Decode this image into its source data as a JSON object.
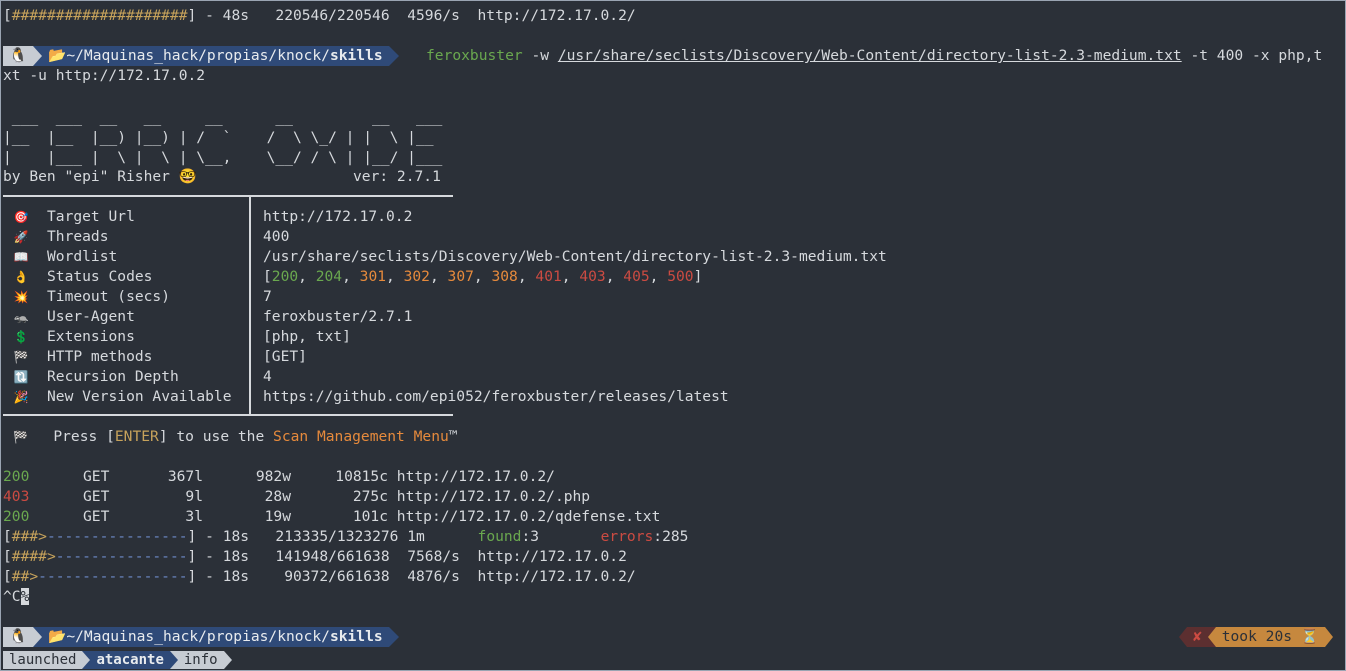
{
  "top_progress": {
    "bar": "####################",
    "time": "- 48s",
    "count": "220546/220546",
    "rate": "4596/s",
    "url": "http://172.17.0.2/"
  },
  "prompt": {
    "os_icon": "🐧",
    "folder_icon": "📂",
    "path_prefix": "~/Maquinas_hack/propias/knock/",
    "path_bold": "skills"
  },
  "command": {
    "program": "feroxbuster",
    "arg1": "-w",
    "wordlist": "/usr/share/seclists/Discovery/Web-Content/directory-list-2.3-medium.txt",
    "rest": "-t 400 -x php,t",
    "wrap": "xt -u http://172.17.0.2"
  },
  "banner": {
    "art": [
      " ___  ___  __   __     __      __         __   ___",
      "|__  |__  |__) |__) | /  `    /  \\ \\_/ | |  \\ |__",
      "|    |___ |  \\ |  \\ | \\__,    \\__/ / \\ | |__/ |___"
    ],
    "byline": "by Ben \"epi\" Risher",
    "emoji": "🤓",
    "version": "ver: 2.7.1"
  },
  "config": [
    {
      "icon": "🎯",
      "label": "Target Url",
      "value": "http://172.17.0.2"
    },
    {
      "icon": "🚀",
      "label": "Threads",
      "value": "400"
    },
    {
      "icon": "📖",
      "label": "Wordlist",
      "value": "/usr/share/seclists/Discovery/Web-Content/directory-list-2.3-medium.txt"
    },
    {
      "icon": "👌",
      "label": "Status Codes",
      "value": ""
    },
    {
      "icon": "💥",
      "label": "Timeout (secs)",
      "value": "7"
    },
    {
      "icon": "🦡",
      "label": "User-Agent",
      "value": "feroxbuster/2.7.1"
    },
    {
      "icon": "💲",
      "label": "Extensions",
      "value": "[php, txt]"
    },
    {
      "icon": "🏁",
      "label": "HTTP methods",
      "value": "[GET]"
    },
    {
      "icon": "🔃",
      "label": "Recursion Depth",
      "value": "4"
    },
    {
      "icon": "🎉",
      "label": "New Version Available",
      "value": "https://github.com/epi052/feroxbuster/releases/latest"
    }
  ],
  "status_codes": [
    {
      "code": "200",
      "color": "#6aa84f"
    },
    {
      "code": "204",
      "color": "#6aa84f"
    },
    {
      "code": "301",
      "color": "#e68a3c"
    },
    {
      "code": "302",
      "color": "#e68a3c"
    },
    {
      "code": "307",
      "color": "#e68a3c"
    },
    {
      "code": "308",
      "color": "#e68a3c"
    },
    {
      "code": "401",
      "color": "#cc4b42"
    },
    {
      "code": "403",
      "color": "#cc4b42"
    },
    {
      "code": "405",
      "color": "#cc4b42"
    },
    {
      "code": "500",
      "color": "#cc4b42"
    }
  ],
  "scan_menu": {
    "icon": "🏁",
    "pre": "Press [",
    "key": "ENTER",
    "mid": "] to use the ",
    "menu": "Scan Management Menu",
    "tm": "™"
  },
  "results": [
    {
      "status": "200",
      "color": "#6aa84f",
      "method": "GET",
      "lines": "367l",
      "words": "982w",
      "chars": "10815c",
      "url": "http://172.17.0.2/"
    },
    {
      "status": "403",
      "color": "#cc4b42",
      "method": "GET",
      "lines": "9l",
      "words": "28w",
      "chars": "275c",
      "url": "http://172.17.0.2/.php"
    },
    {
      "status": "200",
      "color": "#6aa84f",
      "method": "GET",
      "lines": "3l",
      "words": "19w",
      "chars": "101c",
      "url": "http://172.17.0.2/qdefense.txt"
    }
  ],
  "progress": [
    {
      "fill": "###>",
      "rest": "----------------",
      "time": "- 18s",
      "count": "213335/1323276",
      "rate": "1m",
      "found_label": "found",
      "found": "3",
      "errors_label": "errors",
      "errors": "285",
      "url": ""
    },
    {
      "fill": "####>",
      "rest": "---------------",
      "time": "- 18s",
      "count": "141948/661638",
      "rate": "7568/s",
      "url": "http://172.17.0.2"
    },
    {
      "fill": "##>",
      "rest": "-----------------",
      "time": "- 18s",
      "count": "90372/661638",
      "rate": "4876/s",
      "url": "http://172.17.0.2/"
    }
  ],
  "interrupt": {
    "ctrl": "^C",
    "cursor": "%"
  },
  "right_prompt": {
    "exit_icon": "✘",
    "took": "took 20s",
    "hourglass": "⏳"
  },
  "tmux": {
    "tabs": [
      {
        "label": "launched",
        "active": false
      },
      {
        "label": "atacante",
        "active": true
      },
      {
        "label": "info",
        "active": false
      }
    ]
  },
  "colors": {
    "bg": "#2b3038",
    "prompt_bg": "#3f4a57",
    "path_bg": "#1f2937",
    "cmd": "#6aa84f",
    "ok": "#6aa84f",
    "redirect": "#e68a3c",
    "error": "#cc4b42",
    "took_bg": "#c6883e"
  }
}
